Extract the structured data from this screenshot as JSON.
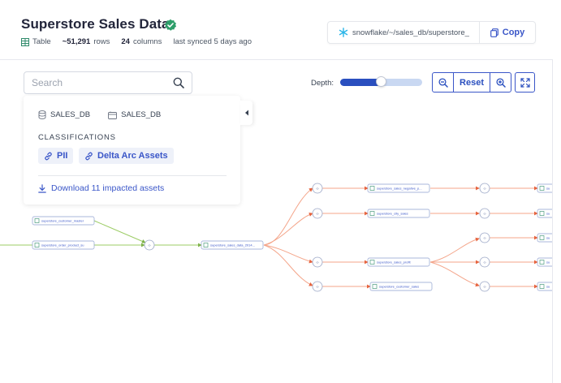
{
  "header": {
    "title": "Superstore Sales Data",
    "asset_type": "Table",
    "rows": "~51,291",
    "rows_label": "rows",
    "columns": "24",
    "columns_label": "columns",
    "synced": "last synced 5 days ago",
    "path": "snowflake/~/sales_db/superstore_",
    "copy_label": "Copy"
  },
  "search": {
    "placeholder": "Search"
  },
  "panel": {
    "database": "SALES_DB",
    "schema": "SALES_DB",
    "classifications_title": "CLASSIFICATIONS",
    "classifications": [
      "PII",
      "Delta Arc Assets"
    ],
    "download_label": "Download 11 impacted assets"
  },
  "controls": {
    "depth_label": "Depth:",
    "depth_value": 0.5,
    "reset_label": "Reset"
  },
  "colors": {
    "accent": "#3a56c8",
    "upstream_edge": "#9ccc65",
    "downstream_edge": "#f4a58a",
    "verified": "#2e9e6a"
  },
  "graph": {
    "nodes": [
      {
        "id": "n1",
        "label": "superstore_customer_master"
      },
      {
        "id": "n2",
        "label": "superstore_order_product_su"
      },
      {
        "id": "n3",
        "label": "superstore_sales_data_2014..."
      },
      {
        "id": "n4",
        "label": "superstore_sales_negative_p..."
      },
      {
        "id": "n5",
        "label": "superstore_city_sales"
      },
      {
        "id": "n6",
        "label": "superstore_sales_profit"
      },
      {
        "id": "n7",
        "label": "superstore_customer_sales"
      },
      {
        "id": "n8",
        "label": "su"
      },
      {
        "id": "n9",
        "label": "su"
      },
      {
        "id": "n10",
        "label": "su"
      },
      {
        "id": "n11",
        "label": "su"
      },
      {
        "id": "n12",
        "label": "su"
      }
    ]
  }
}
